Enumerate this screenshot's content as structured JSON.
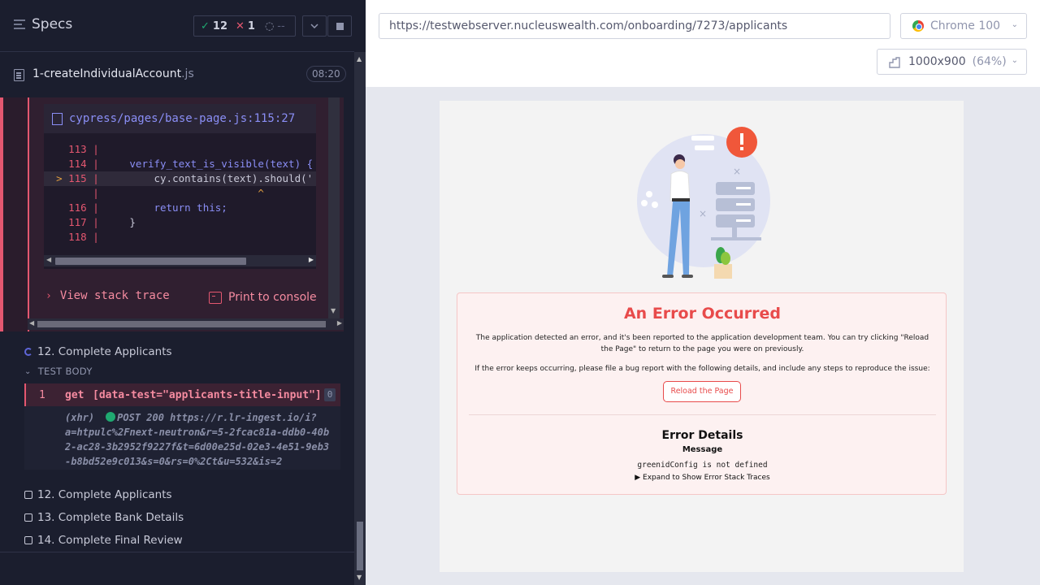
{
  "reporter": {
    "specs_label": "Specs",
    "stats": {
      "passed": "12",
      "failed": "1",
      "pending": "--"
    },
    "file": {
      "name": "1-createIndividualAccount",
      "ext": ".js",
      "duration": "08:20"
    },
    "error": {
      "code_file": "cypress/pages/base-page.js:115:27",
      "lines": [
        {
          "num": "113",
          "code": ""
        },
        {
          "num": "114",
          "code": "verify_text_is_visible(text) {"
        },
        {
          "num": "115",
          "code": "cy.contains(text).should('"
        },
        {
          "num": "",
          "code": "^"
        },
        {
          "num": "116",
          "code": "return this;"
        },
        {
          "num": "117",
          "code": "}"
        },
        {
          "num": "118",
          "code": ""
        }
      ],
      "view_stack": "View stack trace",
      "print_console": "Print to console"
    },
    "tests": {
      "running": "12. Complete Applicants",
      "test_body": "TEST BODY",
      "command": {
        "num": "1",
        "name": "get",
        "message": "[data-test=\"applicants-title-input\"]",
        "badge": "0"
      },
      "xhr": {
        "label": "(xhr)",
        "status": "POST 200",
        "url_start": "https://r.lr-ingest.io/i?",
        "url_rest": "a=htpulc%2Fnext-neutron&r=5-2fcac81a-ddb0-40b2-ac28-3b2952f9227f&t=6d00e25d-02e3-4e51-9eb3-b8bd52e9c013&s=0&rs=0%2Ct&u=532&is=2"
      },
      "pending": [
        "12. Complete Applicants",
        "13. Complete Bank Details",
        "14. Complete Final Review"
      ]
    }
  },
  "aut": {
    "url": "https://testwebserver.nucleuswealth.com/onboarding/7273/applicants",
    "browser": "Chrome 100",
    "viewport": "1000x900",
    "scale": "(64%)",
    "error_page": {
      "title": "An Error Occurred",
      "p1": "The application detected an error, and it's been reported to the application development team. You can try clicking \"Reload the Page\" to return to the page you were on previously.",
      "p2": "If the error keeps occurring, please file a bug report with the following details, and include any steps to reproduce the issue:",
      "reload": "Reload the Page",
      "details_title": "Error Details",
      "message_label": "Message",
      "message": "greenidConfig is not defined",
      "expand": "▶ Expand to Show Error Stack Traces"
    }
  },
  "colors": {
    "fail": "#e45770",
    "pass": "#1fa971",
    "error_title": "#e84b4b",
    "link": "#8a8ef5"
  }
}
